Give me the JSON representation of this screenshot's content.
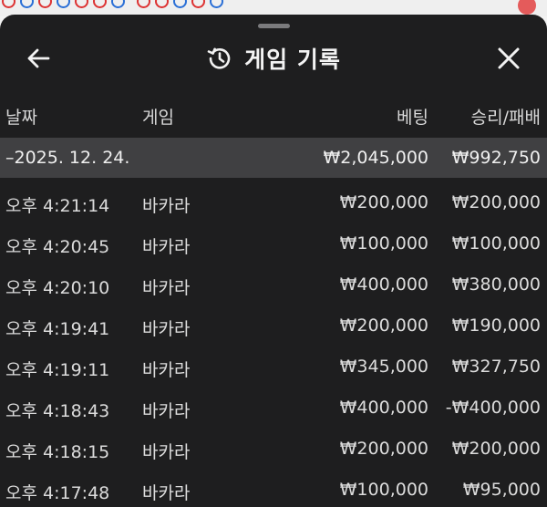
{
  "header": {
    "title": "게임 기록",
    "back_icon": "arrow-left-icon",
    "history_icon": "history-icon",
    "close_icon": "close-icon"
  },
  "columns": {
    "date": "날짜",
    "game": "게임",
    "bet": "베팅",
    "result": "승리/패배"
  },
  "date_group": {
    "date": "–2025. 12. 24.",
    "total_bet": "₩2,045,000",
    "total_result": "₩992,750"
  },
  "rows": [
    {
      "time": "오후 4:21:14",
      "game": "바카라",
      "bet": "₩200,000",
      "result": "₩200,000"
    },
    {
      "time": "오후 4:20:45",
      "game": "바카라",
      "bet": "₩100,000",
      "result": "₩100,000"
    },
    {
      "time": "오후 4:20:10",
      "game": "바카라",
      "bet": "₩400,000",
      "result": "₩380,000"
    },
    {
      "time": "오후 4:19:41",
      "game": "바카라",
      "bet": "₩200,000",
      "result": "₩190,000"
    },
    {
      "time": "오후 4:19:11",
      "game": "바카라",
      "bet": "₩345,000",
      "result": "₩327,750"
    },
    {
      "time": "오후 4:18:43",
      "game": "바카라",
      "bet": "₩400,000",
      "result": "-₩400,000"
    },
    {
      "time": "오후 4:18:15",
      "game": "바카라",
      "bet": "₩200,000",
      "result": "₩200,000"
    },
    {
      "time": "오후 4:17:48",
      "game": "바카라",
      "bet": "₩100,000",
      "result": "₩95,000"
    }
  ],
  "colors": {
    "sheet_bg": "#1e1e1f",
    "date_row_bg": "#404042",
    "text": "#e6e6e6"
  }
}
